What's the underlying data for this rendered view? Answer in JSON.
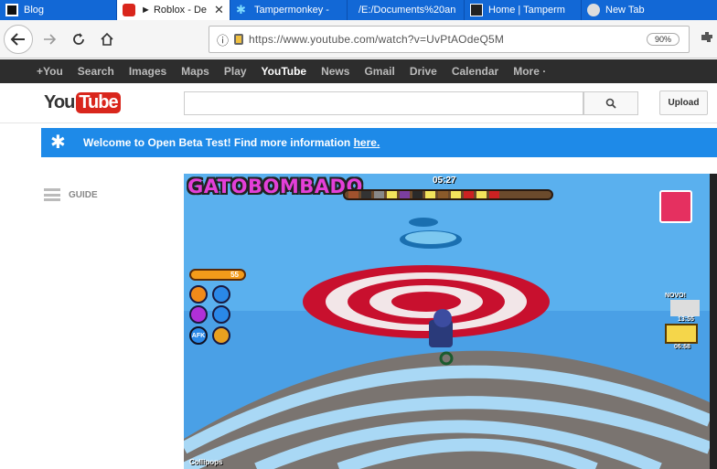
{
  "browser": {
    "tabs": [
      {
        "label": "Blog",
        "icon": "blogger-icon",
        "active": false
      },
      {
        "label": "► Roblox - De",
        "icon": "youtube-icon",
        "active": true
      },
      {
        "label": "Tampermonkey -",
        "icon": "tampermonkey-icon",
        "active": false
      },
      {
        "label": "/E:/Documents%20an",
        "icon": "file-icon",
        "active": false
      },
      {
        "label": "Home | Tamperm",
        "icon": "tampermonkey-home-icon",
        "active": false
      },
      {
        "label": "New Tab",
        "icon": "new-tab-icon",
        "active": false
      }
    ],
    "url": "https://www.youtube.com/watch?v=UvPtAOdeQ5M",
    "zoom": "90%"
  },
  "google_bar": {
    "items": [
      "+You",
      "Search",
      "Images",
      "Maps",
      "Play",
      "YouTube",
      "News",
      "Gmail",
      "Drive",
      "Calendar",
      "More ·"
    ],
    "active": "YouTube"
  },
  "youtube": {
    "logo_you": "You",
    "logo_tube": "Tube",
    "search_placeholder": "",
    "upload_label": "Upload",
    "banner_text": "Welcome to Open Beta Test! Find more information ",
    "banner_link": "here.",
    "guide_label": "GUIDE"
  },
  "video": {
    "game_title": "GATOBOMBADO",
    "timer": "05:27",
    "coins": "55",
    "afk_label": "AFK",
    "watermark": "Collipops",
    "side_time_1": "13:55",
    "side_time_2": "06:68",
    "new_badge": "NOVO!"
  },
  "colors": {
    "tabstrip": "#1268d6",
    "banner": "#1e8ae8",
    "youtube_red": "#d9261c",
    "gbar": "#2d2d2d"
  }
}
